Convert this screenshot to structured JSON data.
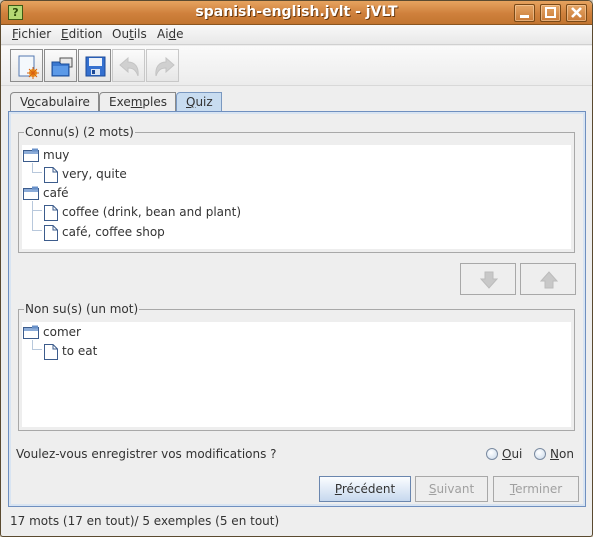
{
  "window": {
    "title": "spanish-english.jvlt - jVLT",
    "app_icon": "?",
    "controls": {
      "minimize": "_",
      "maximize": "□",
      "close": "×"
    }
  },
  "menubar": {
    "items": [
      {
        "label": "Fichier",
        "mnemonic_index": 0
      },
      {
        "label": "Edition",
        "mnemonic_index": 0
      },
      {
        "label": "Outils",
        "mnemonic_index": 2
      },
      {
        "label": "Aide",
        "mnemonic_index": 2
      }
    ],
    "fichier": {
      "pre": "",
      "u": "F",
      "post": "ichier"
    },
    "edition": {
      "pre": "",
      "u": "E",
      "post": "dition"
    },
    "outils": {
      "pre": "Ou",
      "u": "t",
      "post": "ils"
    },
    "aide": {
      "pre": "Ai",
      "u": "d",
      "post": "e"
    }
  },
  "toolbar": {
    "buttons": [
      {
        "name": "new-file",
        "icon": "new-document-icon",
        "enabled": true
      },
      {
        "name": "open-file",
        "icon": "open-folder-icon",
        "enabled": true
      },
      {
        "name": "save-file",
        "icon": "save-floppy-icon",
        "enabled": true
      },
      {
        "name": "undo",
        "icon": "undo-arrow-icon",
        "enabled": false
      },
      {
        "name": "redo",
        "icon": "redo-arrow-icon",
        "enabled": false
      }
    ]
  },
  "tabs": {
    "vocabulaire": {
      "pre": "V",
      "u": "o",
      "post": "cabulaire"
    },
    "exemples": {
      "pre": "Exe",
      "u": "m",
      "post": "ples"
    },
    "quiz": {
      "pre": "",
      "u": "Q",
      "post": "uiz"
    },
    "active": "Quiz"
  },
  "known": {
    "title": "Connu(s) (2 mots)",
    "entries": [
      {
        "word": "muy",
        "meanings": [
          "very, quite"
        ]
      },
      {
        "word": "café",
        "meanings": [
          "coffee (drink, bean and plant)",
          "café, coffee shop"
        ]
      }
    ]
  },
  "unknown": {
    "title": "Non su(s) (un mot)",
    "entries": [
      {
        "word": "comer",
        "meanings": [
          "to eat"
        ]
      }
    ]
  },
  "move_buttons": {
    "down": {
      "icon": "arrow-down-icon",
      "enabled": false
    },
    "up": {
      "icon": "arrow-up-icon",
      "enabled": false
    }
  },
  "save_prompt": {
    "question": "Voulez-vous enregistrer vos modifications ?",
    "oui": {
      "u": "O",
      "post": "ui",
      "selected": false
    },
    "non": {
      "u": "N",
      "post": "on",
      "selected": false
    }
  },
  "nav": {
    "previous": {
      "u": "P",
      "post": "récédent",
      "enabled": true
    },
    "next": {
      "u": "S",
      "post": "uivant",
      "enabled": false
    },
    "finish": {
      "u": "T",
      "post": "erminer",
      "enabled": false
    }
  },
  "status": "17 mots (17 en tout)/ 5 exemples (5 en tout)",
  "colors": {
    "titlebar": "#cf803c",
    "tab_active": "#c8dcf0",
    "panel_border": "#6f8fbf",
    "disabled_text": "#a0a0a0"
  }
}
